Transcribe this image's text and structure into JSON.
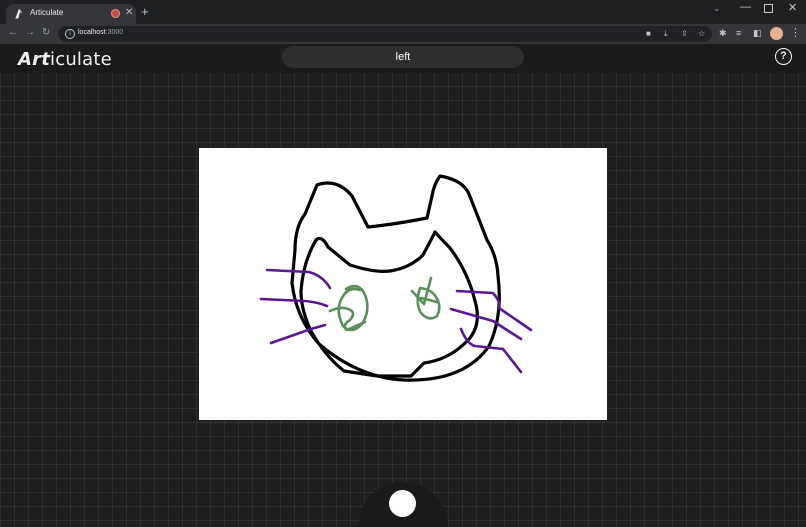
{
  "browser": {
    "tab_title": "Articulate",
    "url_host": "localhost",
    "url_port": ":3000",
    "icons": [
      "back-arrow-icon",
      "forward-arrow-icon",
      "reload-icon",
      "site-info-icon",
      "camera-icon",
      "download-icon",
      "share-icon",
      "star-icon",
      "extensions-icon",
      "media-icon",
      "side-panel-icon",
      "profile-avatar",
      "menu-icon"
    ]
  },
  "app": {
    "logo_art": "Art",
    "logo_rest": "iculate",
    "prompt": "left",
    "help_label": "?"
  },
  "colors": {
    "outline": "#000000",
    "eyes": "#5a8f5a",
    "whiskers": "#5b1596",
    "canvas": "#ffffff",
    "background": "#1f1f1f"
  }
}
